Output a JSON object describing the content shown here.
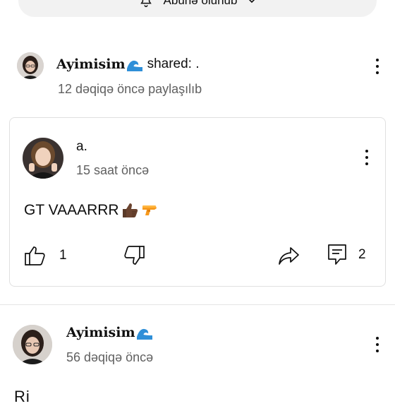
{
  "subscribe_bar": {
    "label": "Abunə olunub"
  },
  "post": {
    "author": "Ayimisim",
    "author_emoji": "🌊",
    "action": "shared: .",
    "time": "12 dəqiqə öncə paylaşılıb"
  },
  "shared_card": {
    "author": "a.",
    "time": "15 saat öncə",
    "text": "GT VAAARRR",
    "emojis": [
      "thumbs-up-dark-skin",
      "water-pistol"
    ],
    "likes": "1",
    "comments": "2"
  },
  "post2": {
    "author": "Ayimisim",
    "author_emoji": "🌊",
    "time": "56 dəqiqə öncə",
    "text_partial": "Ri"
  },
  "colors": {
    "text": "#0f0f0f",
    "meta": "#606060",
    "wave": "#2f8fd8"
  }
}
